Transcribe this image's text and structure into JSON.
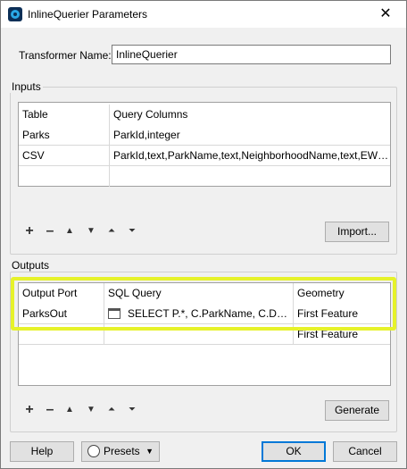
{
  "window": {
    "title": "InlineQuerier Parameters",
    "close_glyph": "✕"
  },
  "transformer": {
    "label": "Transformer Name:",
    "value": "InlineQuerier"
  },
  "inputs": {
    "group_label": "Inputs",
    "columns": [
      "Table",
      "Query Columns"
    ],
    "rows": [
      [
        "Parks",
        "ParkId,integer"
      ],
      [
        "CSV",
        "ParkId,text,ParkName,text,NeighborhoodName,text,EWS..."
      ],
      [
        "",
        ""
      ]
    ],
    "import_label": "Import..."
  },
  "outputs": {
    "group_label": "Outputs",
    "columns": [
      "Output Port",
      "SQL Query",
      "Geometry"
    ],
    "rows": [
      [
        "ParksOut",
        "SELECT P.*, C.ParkName, C.DogP...",
        "First Feature"
      ],
      [
        "",
        "",
        "First Feature"
      ]
    ],
    "generate_label": "Generate"
  },
  "toolbar_icons": [
    "plus-icon",
    "minus-icon",
    "move-up-icon",
    "move-down-icon",
    "move-top-icon",
    "move-bottom-icon"
  ],
  "footer": {
    "help": "Help",
    "presets": "Presets",
    "ok": "OK",
    "cancel": "Cancel"
  },
  "colors": {
    "highlight": "#e6f22a",
    "accent": "#0078d7"
  }
}
